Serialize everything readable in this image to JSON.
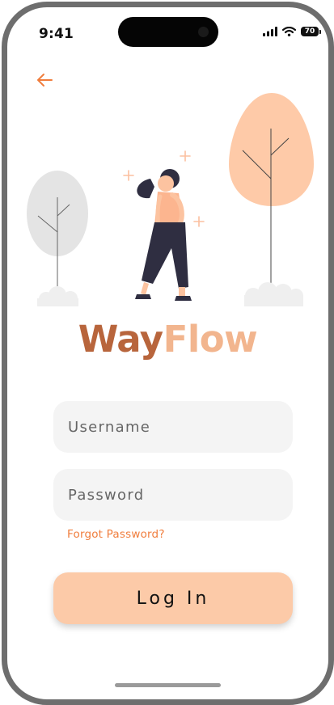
{
  "status_bar": {
    "time": "9:41",
    "battery": "70"
  },
  "app": {
    "logo_part1": "Way",
    "logo_part2": "Flow"
  },
  "form": {
    "username_placeholder": "Username",
    "username_value": "",
    "password_placeholder": "Password",
    "password_value": "",
    "forgot_label": "Forgot Password?",
    "login_label": "Log In"
  },
  "colors": {
    "accent": "#f07d3c",
    "brand_dark": "#b8653c",
    "brand_light": "#f2b58e",
    "button": "#fccaa8",
    "field_bg": "#f4f4f4"
  },
  "icons": [
    "back-arrow-icon",
    "signal-icon",
    "wifi-icon",
    "battery-icon"
  ]
}
